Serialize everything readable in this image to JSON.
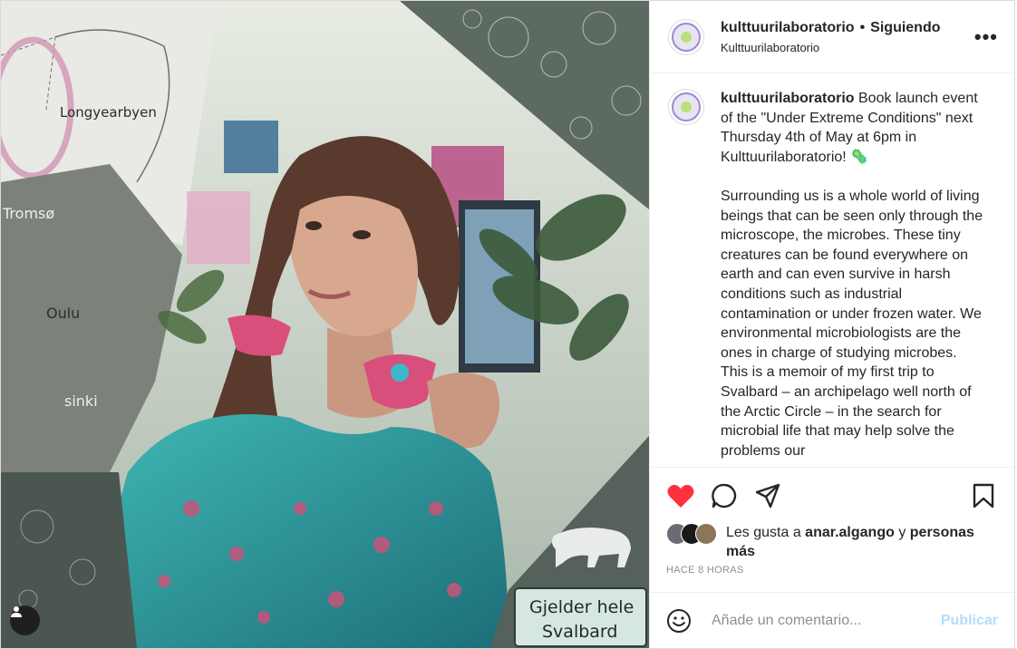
{
  "header": {
    "username": "kulttuurilaboratorio",
    "separator": "•",
    "follow_status": "Siguiendo",
    "subtitle": "Kulttuurilaboratorio",
    "more_icon": "more-icon"
  },
  "caption": {
    "username": "kulttuurilaboratorio",
    "text": " Book launch event of the \"Under Extreme Conditions\" next Thursday 4th of May at 6pm in Kulttuurilaboratorio! 🦠\n\nSurrounding us is a whole world of living beings that can be seen only through the microscope, the microbes. These tiny creatures can be found everywhere on earth and can even survive in harsh conditions such as industrial contamination or under frozen water. We environmental microbiologists are the ones in charge of studying microbes. This is a memoir of my first trip to Svalbard – an archipelago well north of the Arctic Circle – in the search for microbial life that may help solve the problems our"
  },
  "image": {
    "map_labels": [
      "Longyearbyen",
      "Tromsø",
      "Oulu",
      "sinki"
    ],
    "sign_line1": "Gjelder hele",
    "sign_line2": "Svalbard"
  },
  "actions": {
    "icons": [
      "heart-icon",
      "comment-icon",
      "share-icon",
      "bookmark-icon"
    ],
    "liked": true,
    "like_color": "#ff3040"
  },
  "likes": {
    "prefix": "Les gusta a ",
    "user": "anar.algango",
    "connector": " y ",
    "rest": "personas más"
  },
  "timestamp": "HACE 8 HORAS",
  "comment": {
    "placeholder": "Añade un comentario...",
    "publish_label": "Publicar"
  },
  "colors": {
    "border": "#dbdbdb",
    "muted": "#8e8e8e",
    "publish": "#b2dffc"
  }
}
